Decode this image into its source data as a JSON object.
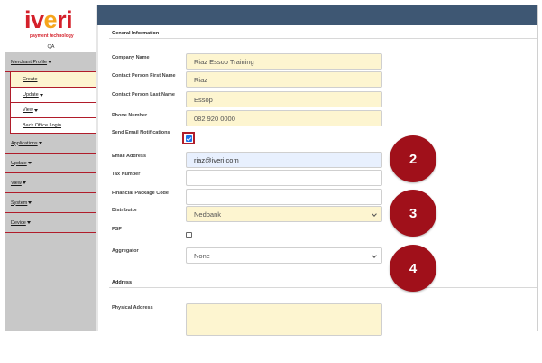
{
  "logo": {
    "brand_prefix": "i",
    "brand_mid": "v",
    "brand_e": "e",
    "brand_suffix": "ri",
    "tagline": "payment technology"
  },
  "env_label": "QA",
  "sidebar": {
    "items": [
      {
        "label": "Merchant Profile"
      },
      {
        "label": "Create"
      },
      {
        "label": "Update"
      },
      {
        "label": "View"
      },
      {
        "label": "Back Office Login"
      },
      {
        "label": "Applications"
      },
      {
        "label": "Update"
      },
      {
        "label": "View"
      },
      {
        "label": "System"
      },
      {
        "label": "Device"
      }
    ]
  },
  "general": {
    "title": "General Information",
    "company_name": {
      "label": "Company Name",
      "value": "Riaz Essop Training"
    },
    "first_name": {
      "label": "Contact Person First Name",
      "value": "Riaz"
    },
    "last_name": {
      "label": "Contact Person Last Name",
      "value": "Essop"
    },
    "phone": {
      "label": "Phone Number",
      "value": "082 920 0000"
    },
    "send_email": {
      "label": "Send Email Notifications",
      "checked": true
    },
    "email": {
      "label": "Email Address",
      "value": "riaz@iveri.com"
    },
    "tax": {
      "label": "Tax Number",
      "value": ""
    },
    "fin_pkg": {
      "label": "Financial Package Code",
      "value": ""
    },
    "distributor": {
      "label": "Distributor",
      "value": "Nedbank"
    },
    "psp": {
      "label": "PSP",
      "checked": false
    },
    "aggregator": {
      "label": "Aggregator",
      "value": "None"
    }
  },
  "address": {
    "title": "Address",
    "physical": {
      "label": "Physical Address",
      "value": ""
    }
  },
  "callouts": [
    "2",
    "3",
    "4"
  ],
  "colors": {
    "topbar": "#3e5773",
    "accent": "#b01c2a",
    "callout": "#a0101a",
    "field": "#fdf5d0"
  }
}
